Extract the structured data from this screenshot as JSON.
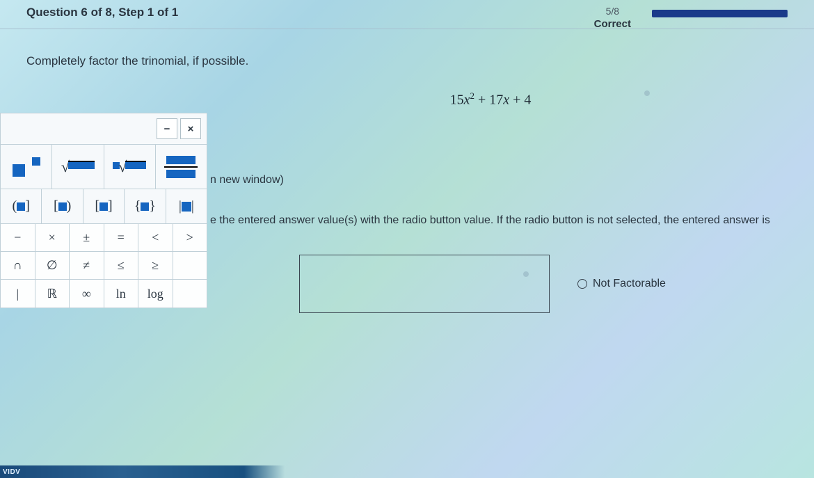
{
  "header": {
    "question_label": "Question 6 of 8, Step 1 of 1",
    "score_fraction": "5/8",
    "correct_label": "Correct"
  },
  "prompt": "Completely factor the trinomial, if possible.",
  "equation": {
    "pre": "15",
    "var1": "x",
    "sup": "2",
    "mid": " + 17",
    "var2": "x",
    "post": " + 4"
  },
  "palette": {
    "minimize": "−",
    "close": "×",
    "brackets": {
      "paren": [
        "(",
        ")"
      ],
      "square": [
        "[",
        "]"
      ],
      "curly": [
        "{",
        "}"
      ],
      "abs": [
        "|",
        "|"
      ]
    },
    "ops_row1": [
      "−",
      "×",
      "±",
      "=",
      "<",
      ">"
    ],
    "ops_row2": [
      "∩",
      "∅",
      "≠",
      "≤",
      "≥"
    ],
    "ops_row3": [
      "|",
      "ℝ",
      "∞",
      "ln",
      "log"
    ]
  },
  "body": {
    "new_window": "n new window)",
    "instruction": "e the entered answer value(s) with the radio button value. If the radio button is not selected, the entered answer is",
    "radio_label": "Not Factorable"
  },
  "footer_tag": "VIDV"
}
